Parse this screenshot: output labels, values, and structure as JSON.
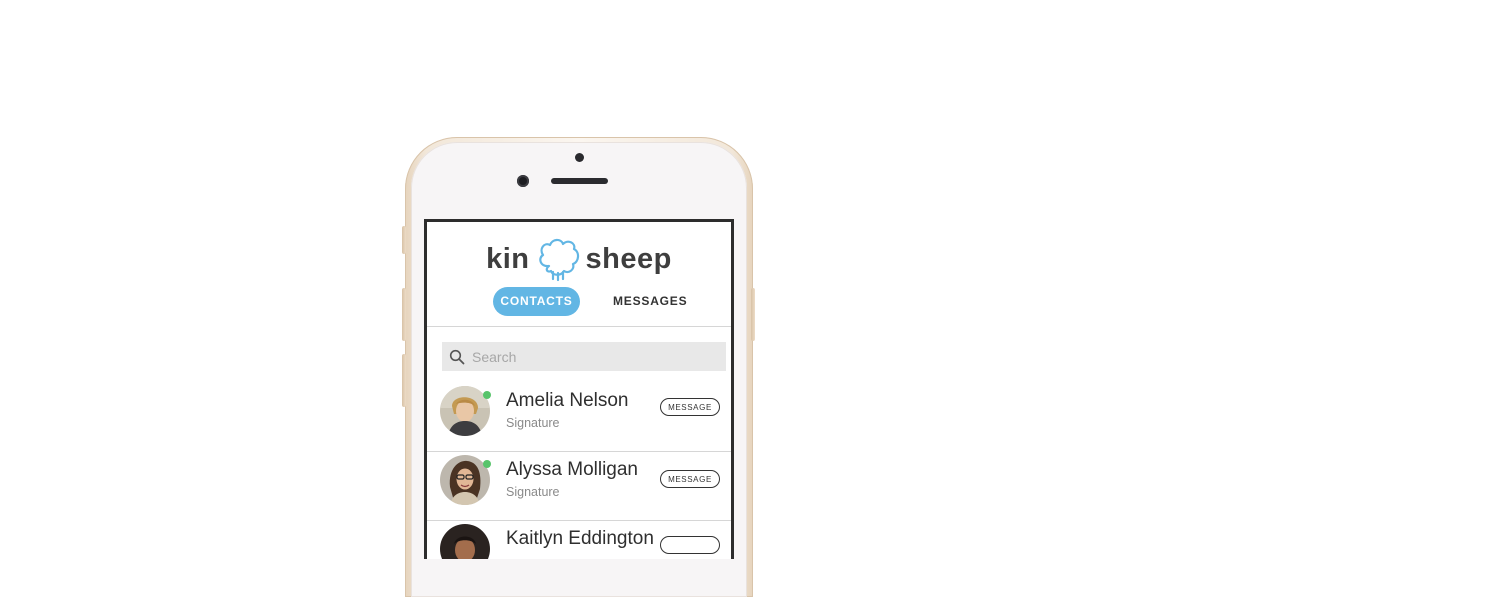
{
  "app": {
    "logo_left": "kin",
    "logo_right": "sheep"
  },
  "tabs": [
    {
      "label": "CONTACTS",
      "active": true
    },
    {
      "label": "MESSAGES",
      "active": false
    }
  ],
  "search": {
    "placeholder": "Search",
    "value": ""
  },
  "contacts": [
    {
      "name": "Amelia Nelson",
      "subtitle": "Signature",
      "online": true,
      "action_label": "MESSAGE"
    },
    {
      "name": "Alyssa Molligan",
      "subtitle": "Signature",
      "online": true,
      "action_label": "MESSAGE"
    },
    {
      "name": "Kaitlyn Eddington",
      "subtitle": "",
      "online": false,
      "action_label": ""
    }
  ],
  "colors": {
    "accent": "#62b6e4",
    "online": "#58c46b",
    "phone_frame": "#efe2d2",
    "screen_bezel": "#2d2d2d"
  },
  "icons": [
    "search-icon",
    "sheep-logo-icon",
    "online-status-icon"
  ]
}
